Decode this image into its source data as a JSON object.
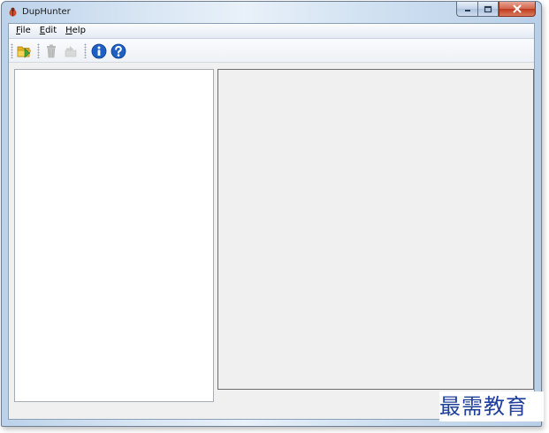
{
  "window": {
    "title": "DupHunter"
  },
  "menu": {
    "items": [
      {
        "label": "File",
        "accel": "F",
        "rest": "ile"
      },
      {
        "label": "Edit",
        "accel": "E",
        "rest": "dit"
      },
      {
        "label": "Help",
        "accel": "H",
        "rest": "elp"
      }
    ]
  },
  "toolbar": {
    "buttons": [
      {
        "icon": "open-folder-icon",
        "enabled": true
      },
      {
        "icon": "trash-icon",
        "enabled": false
      },
      {
        "icon": "move-icon",
        "enabled": false
      },
      {
        "icon": "info-icon",
        "enabled": true
      },
      {
        "icon": "help-icon",
        "enabled": true
      }
    ]
  },
  "watermark": {
    "text": "最需教育"
  },
  "colors": {
    "info_blue": "#1d5fc4",
    "watermark_blue": "#1f3f9c",
    "close_red": "#c0391f"
  }
}
